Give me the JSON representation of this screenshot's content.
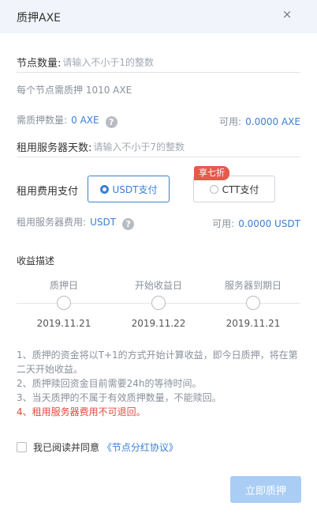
{
  "dialog": {
    "title": "质押AXE",
    "close_glyph": "×"
  },
  "node_count": {
    "label": "节点数量:",
    "placeholder": "请输入不小于1的整数",
    "hint": "每个节点需质押 1010 AXE"
  },
  "pledge_amount": {
    "label": "需质押数量:",
    "value": "0 AXE",
    "available_label": "可用:",
    "available_value": "0.0000 AXE"
  },
  "rent_days": {
    "label": "租用服务器天数:",
    "placeholder": "请输入不小于7的整数"
  },
  "payment": {
    "label": "租用费用支付",
    "options": [
      {
        "label": "USDT支付",
        "selected": true
      },
      {
        "label": "CTT支付",
        "selected": false,
        "badge": "享七折"
      }
    ]
  },
  "server_fee": {
    "label": "租用服务器费用:",
    "value": "USDT",
    "available_label": "可用:",
    "available_value": "0.0000 USDT"
  },
  "earnings": {
    "title": "收益描述",
    "steps": [
      {
        "label": "质押日",
        "date": "2019.11.21"
      },
      {
        "label": "开始收益日",
        "date": "2019.11.22"
      },
      {
        "label": "服务器到期日",
        "date": "2019.11.21"
      }
    ]
  },
  "notes": [
    "1、质押的资金将以T+1的方式开始计算收益，即今日质押，将在第二天开始收益。",
    "2、质押赎回资金目前需要24h的等待时间。",
    "3、当天质押的不属于有效质押数量，不能赎回。",
    "4、租用服务器费用不可退回。"
  ],
  "agreement": {
    "text": "我已阅读并同意",
    "link": "《节点分红协议》",
    "checked": false
  },
  "submit": {
    "label": "立即质押"
  },
  "colors": {
    "accent": "#3a7fd5",
    "danger": "#e04a3c",
    "badge": "#e65a4c",
    "submit_disabled": "#a9cdf5",
    "header_bg": "#f1f5fb"
  }
}
